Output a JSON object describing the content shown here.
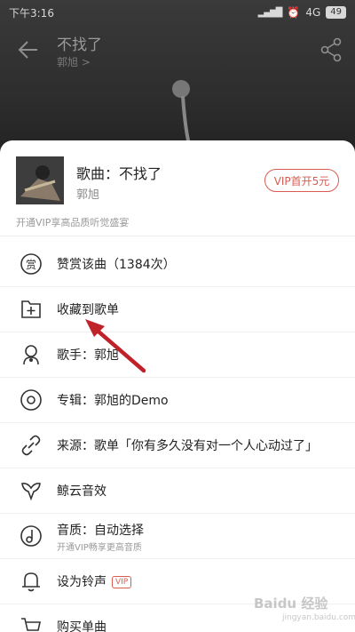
{
  "status_bar": {
    "time": "下午3:16",
    "network": "4G",
    "battery": "49"
  },
  "player": {
    "title": "不找了",
    "artist": "郭旭 >"
  },
  "sheet": {
    "song_name": "歌曲：不找了",
    "song_artist": "郭旭",
    "vip_button": "VIP首开5元",
    "vip_promo": "开通VIP享高品质听觉盛宴",
    "menu": [
      {
        "label": "赞赏该曲（1384次）",
        "icon": "reward-icon"
      },
      {
        "label": "收藏到歌单",
        "icon": "add-to-playlist-icon"
      },
      {
        "label": "歌手：郭旭",
        "icon": "singer-icon"
      },
      {
        "label": "专辑：郭旭的Demo",
        "icon": "album-icon"
      },
      {
        "label": "来源：歌单「你有多久没有对一个人心动过了」",
        "icon": "link-icon"
      },
      {
        "label": "鲸云音效",
        "icon": "sound-effect-icon"
      },
      {
        "label": "音质：自动选择",
        "sub": "开通VIP畅享更高音质",
        "icon": "quality-icon"
      },
      {
        "label": "设为铃声",
        "tag": "VIP",
        "icon": "bell-icon"
      },
      {
        "label": "购买单曲",
        "icon": "cart-icon"
      }
    ]
  },
  "watermark": {
    "text": "Baidu 经验",
    "sub": "jingyan.baidu.com"
  },
  "colors": {
    "accent": "#d95c52",
    "annotation": "#c0222a"
  }
}
